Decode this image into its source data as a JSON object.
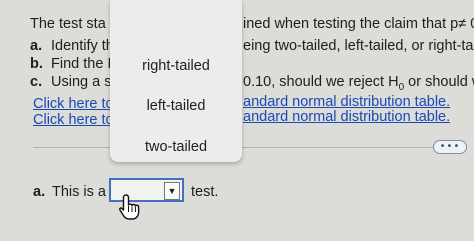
{
  "question": {
    "intro_left": "The test sta",
    "intro_right": "ined when testing the claim that p≠ 0.",
    "a_label": "a.",
    "a_text": "Identify th",
    "a_right": "eing two-tailed, left-tailed, or right-taile",
    "b_label": "b.",
    "b_text": "Find the I",
    "c_label": "c.",
    "c_text": "Using a s",
    "c_right_pre": "0.10, should we reject H",
    "c_right_sub": "0",
    "c_right_post": " or should w"
  },
  "links": {
    "left_1": "Click here tc",
    "left_2": "Click here tc",
    "right_1": "andard normal distribution table.",
    "right_2": "andard normal distribution table."
  },
  "more_button": "•••",
  "dropdown": {
    "options": [
      "right-tailed",
      "left-tailed",
      "two-tailed"
    ],
    "selected": "",
    "arrow": "▼"
  },
  "answer": {
    "prefix_label": "a.",
    "prefix_text": "This is a",
    "suffix": "test."
  },
  "icons": {
    "cursor": "hand-pointer-icon",
    "more": "ellipsis-icon",
    "dropdown": "chevron-down-icon"
  },
  "colors": {
    "link": "#1d49b5",
    "select_border": "#4470c4",
    "background": "#dcdcd8"
  }
}
